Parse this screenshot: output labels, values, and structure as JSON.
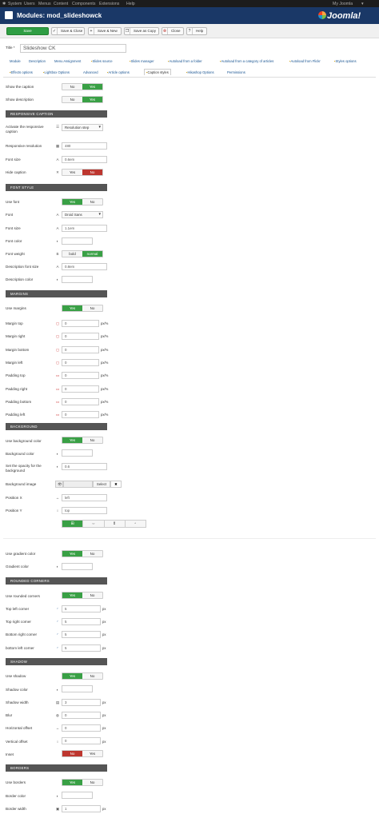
{
  "topnav": {
    "menu": [
      "System",
      "Users",
      "Menus",
      "Content",
      "Components",
      "Extensions",
      "Help"
    ],
    "user_link": "My Joomla"
  },
  "header": {
    "title": "Modules: mod_slideshowck",
    "brand": "Joomla!"
  },
  "toolbar": {
    "buttons": [
      {
        "label": "Save",
        "icon": "save-icon"
      },
      {
        "label": "Save & Close",
        "icon": "check-icon"
      },
      {
        "label": "Save & New",
        "icon": "plus-icon"
      },
      {
        "label": "Save as Copy",
        "icon": "copy-icon"
      },
      {
        "label": "Close",
        "icon": "close-icon"
      },
      {
        "label": "Help",
        "icon": "help-icon"
      }
    ]
  },
  "title_field": {
    "label": "Title *",
    "value": "Slideshow CK"
  },
  "tabs_row1": [
    "Module",
    "Description",
    "Menu Assignment",
    "Slides source",
    "Slides manager",
    "Autoload from a folder",
    "Autoload from a category of articles",
    "Autoload from Flickr",
    "Styles options"
  ],
  "tabs_row2": [
    "Effects options",
    "Lightbox Options",
    "Advanced",
    "Article options",
    "Caption styles",
    "Hikashop Options",
    "Permissions"
  ],
  "active_tab": "Caption styles",
  "toggle_labels": {
    "yes": "Yes",
    "no": "No",
    "bold": "bold",
    "normal": "normal",
    "px": "px",
    "percent": "%",
    "px_percent": "px/%",
    "select": "Select"
  },
  "top_fields": [
    {
      "label": "Show the caption",
      "value": "Yes"
    },
    {
      "label": "Show description",
      "value": "Yes"
    }
  ],
  "responsive": {
    "heading": "RESPONSIVE CAPTION",
    "activate_label": "Activate the responsive caption",
    "activate_value": "Resolution step",
    "resolution_label": "Responsive resolution",
    "resolution_value": "480",
    "fontsize_label": "Font size",
    "fontsize_value": "0.6em",
    "hide_label": "Hide caption",
    "hide_value": "No"
  },
  "font": {
    "heading": "FONT STYLE",
    "use_label": "Use font",
    "use_value": "Yes",
    "font_label": "Font",
    "font_value": "Droid Sans",
    "size_label": "Font size",
    "size_value": "1.1em",
    "color_label": "Font color",
    "weight_label": "Font weight",
    "weight_value": "normal",
    "desc_size_label": "Description font size",
    "desc_size_value": "0.8em",
    "desc_color_label": "Description color"
  },
  "margins": {
    "heading": "MARGINS",
    "use_label": "Use margins",
    "use_value": "Yes",
    "fields": [
      {
        "label": "Margin top",
        "value": "0"
      },
      {
        "label": "Margin right",
        "value": "0"
      },
      {
        "label": "Margin bottom",
        "value": "0"
      },
      {
        "label": "Margin left",
        "value": "0"
      },
      {
        "label": "Padding top",
        "value": "0"
      },
      {
        "label": "Padding right",
        "value": "0"
      },
      {
        "label": "Padding bottom",
        "value": "0"
      },
      {
        "label": "Padding left",
        "value": "0"
      }
    ]
  },
  "background": {
    "heading": "BACKGROUND",
    "use_label": "Use background color",
    "use_value": "Yes",
    "color_label": "Background color",
    "opacity_label": "Set the opacity for the background",
    "opacity_value": "0.6",
    "image_label": "Background image",
    "posx_label": "Position X",
    "posx_value": "left",
    "posy_label": "Position Y",
    "posy_value": "top",
    "repeat_options": [
      "repeat",
      "repeat-x",
      "repeat-y",
      "no-repeat"
    ],
    "gradient_label": "Use gradient color",
    "gradient_value": "Yes",
    "gradient_color_label": "Gradient color"
  },
  "corners": {
    "heading": "ROUNDED CORNERS",
    "use_label": "Use rounded corners",
    "use_value": "Yes",
    "fields": [
      {
        "label": "Top left corner",
        "value": "5"
      },
      {
        "label": "Top right corner",
        "value": "5"
      },
      {
        "label": "Bottom right corner",
        "value": "5"
      },
      {
        "label": "bottom left corner",
        "value": "5"
      }
    ]
  },
  "shadow": {
    "heading": "SHADOW",
    "use_label": "Use shadow",
    "use_value": "Yes",
    "color_label": "Shadow color",
    "width_label": "Shadow width",
    "width_value": "3",
    "blur_label": "Blur",
    "blur_value": "0",
    "hoff_label": "Horizontal offset",
    "hoff_value": "0",
    "voff_label": "Vertical offset",
    "voff_value": "0",
    "inset_label": "Inset",
    "inset_value": "No"
  },
  "borders": {
    "heading": "BORDERS",
    "use_label": "Use borders",
    "use_value": "Yes",
    "color_label": "Border color",
    "width_label": "Border width",
    "width_value": "1"
  },
  "colors": {
    "header": "#1a3867",
    "save": "#2f9e44",
    "yes": "#39a045",
    "no": "#bd362f",
    "section": "#555555"
  }
}
